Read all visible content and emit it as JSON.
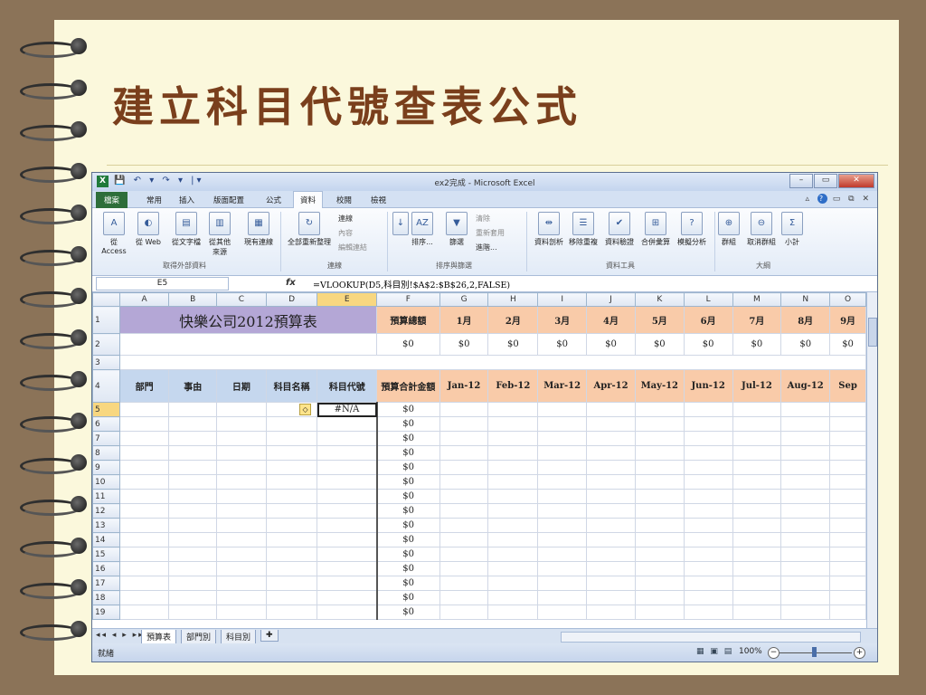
{
  "slide": {
    "title": "建立科目代號查表公式"
  },
  "excel": {
    "window_title": "ex2完成 - Microsoft Excel",
    "quick_access": "💾 ↶ ▾ ↷ ▾ |▾",
    "window_buttons": {
      "minimize": "–",
      "restore": "▭",
      "close": "✕"
    },
    "tabs": [
      "檔案",
      "常用",
      "插入",
      "版面配置",
      "公式",
      "資料",
      "校閱",
      "檢視"
    ],
    "active_tab": "資料",
    "ribbon": {
      "external_data": {
        "buttons": [
          "從 Access",
          "從 Web",
          "從文字檔",
          "從其他來源",
          "現有連線"
        ],
        "label": "取得外部資料"
      },
      "connections": {
        "refresh": "全部重新整理",
        "small": [
          "連線",
          "內容",
          "編輯連結"
        ],
        "label": "連線"
      },
      "sort_filter": {
        "sort": "排序...",
        "filter": "篩選",
        "small": [
          "清除",
          "重新套用",
          "進階..."
        ],
        "label": "排序與篩選"
      },
      "data_tools": {
        "buttons": [
          "資料剖析",
          "移除重複",
          "資料驗證",
          "合併彙算",
          "模擬分析"
        ],
        "label": "資料工具"
      },
      "outline": {
        "buttons": [
          "群組",
          "取消群組",
          "小計"
        ],
        "label": "大綱"
      }
    },
    "name_box": "E5",
    "fx": "fx",
    "formula": "=VLOOKUP(D5,科目別!$A$2:$B$26,2,FALSE)",
    "columns": [
      "A",
      "B",
      "C",
      "D",
      "E",
      "F",
      "G",
      "H",
      "I",
      "J",
      "K",
      "L",
      "M",
      "N",
      "O"
    ],
    "sheet": {
      "title": "快樂公司2012預算表",
      "budget_total_label": "預算總額",
      "months": [
        "1月",
        "2月",
        "3月",
        "4月",
        "5月",
        "6月",
        "7月",
        "8月",
        "9月"
      ],
      "row2_values": [
        "$0",
        "$0",
        "$0",
        "$0",
        "$0",
        "$0",
        "$0",
        "$0",
        "$0",
        "$0"
      ],
      "headers": [
        "部門",
        "事由",
        "日期",
        "科目名稱",
        "科目代號",
        "預算合計金額"
      ],
      "month_headers": [
        "Jan-12",
        "Feb-12",
        "Mar-12",
        "Apr-12",
        "May-12",
        "Jun-12",
        "Jul-12",
        "Aug-12",
        "Sep"
      ],
      "e5_value": "#N/A",
      "warning_icon": "◇",
      "data_rows": [
        {
          "row": "5",
          "total": "$0"
        },
        {
          "row": "6",
          "total": "$0"
        },
        {
          "row": "7",
          "total": "$0"
        },
        {
          "row": "8",
          "total": "$0"
        },
        {
          "row": "9",
          "total": "$0"
        },
        {
          "row": "10",
          "total": "$0"
        },
        {
          "row": "11",
          "total": "$0"
        },
        {
          "row": "12",
          "total": "$0"
        },
        {
          "row": "13",
          "total": "$0"
        },
        {
          "row": "14",
          "total": "$0"
        },
        {
          "row": "15",
          "total": "$0"
        },
        {
          "row": "16",
          "total": "$0"
        },
        {
          "row": "17",
          "total": "$0"
        },
        {
          "row": "18",
          "total": "$0"
        },
        {
          "row": "19",
          "total": "$0"
        }
      ]
    },
    "sheet_tabs": [
      "預算表",
      "部門別",
      "科目別"
    ],
    "status": {
      "ready": "就緒",
      "zoom": "100%"
    }
  }
}
